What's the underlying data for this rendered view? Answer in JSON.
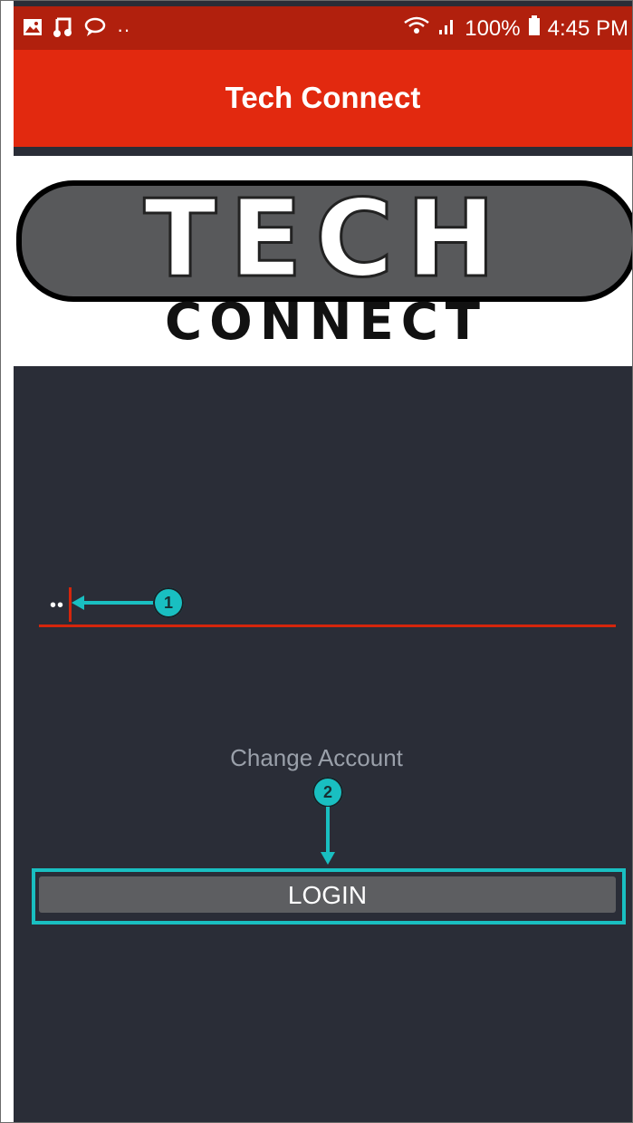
{
  "status_bar": {
    "left_icons": [
      "image-icon",
      "music-icon",
      "chat-icon"
    ],
    "left_dots": "··",
    "wifi_icon": "wifi-icon",
    "signal_icon": "signal-icon",
    "battery_percent": "100%",
    "battery_icon": "battery-icon",
    "time": "4:45 PM"
  },
  "app_bar": {
    "title": "Tech Connect"
  },
  "logo": {
    "top_text": "TECH",
    "bottom_text": "CONNECT"
  },
  "login": {
    "password_value": "••",
    "change_account": "Change Account",
    "button_label": "LOGIN"
  },
  "callouts": [
    "1",
    "2"
  ],
  "colors": {
    "status_bar": "#b1200d",
    "app_bar": "#e2290f",
    "background": "#2a2d37",
    "accent_line": "#d4250c",
    "callout": "#19bfc1",
    "button": "#5d5e61"
  }
}
